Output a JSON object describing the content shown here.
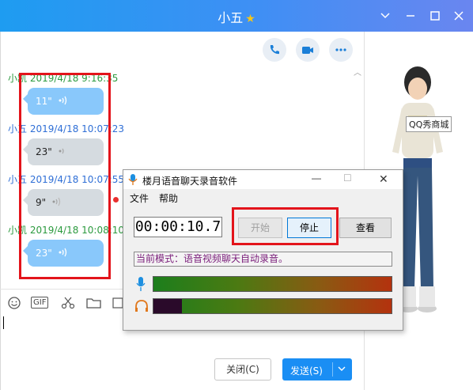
{
  "window": {
    "title": "小五"
  },
  "chat": {
    "messages": [
      {
        "header": "小凯 2019/4/18 9:16:35",
        "duration": "11\"",
        "side": "out"
      },
      {
        "header": "小五 2019/4/18 10:07:23",
        "duration": "23\"",
        "side": "in"
      },
      {
        "header": "小五 2019/4/18 10:07:55",
        "duration": "9\"",
        "side": "in"
      },
      {
        "header": "小凯 2019/4/18 10:08:10",
        "duration": "23\"",
        "side": "out"
      }
    ],
    "toolbar": {
      "gif_label": "GIF"
    },
    "buttons": {
      "close": "关闭(C)",
      "send": "发送(S)"
    }
  },
  "right_panel": {
    "qqshow_label": "QQ秀商城"
  },
  "recorder": {
    "title": "楼月语音聊天录音软件",
    "menu": [
      "文件",
      "帮助"
    ],
    "timer": "00:00:10.7",
    "buttons": {
      "start": "开始",
      "stop": "停止",
      "view": "查看"
    },
    "mode_text": "当前模式：语音视频聊天自动录音。",
    "mic_level": 0.0,
    "speaker_level": 0.12
  },
  "colors": {
    "titlebar": "#3f8ff4",
    "accent": "#1a8ef4",
    "highlight_box": "#e3141b",
    "sender_green": "#2b9a3e",
    "sender_blue": "#2f6fd6"
  }
}
